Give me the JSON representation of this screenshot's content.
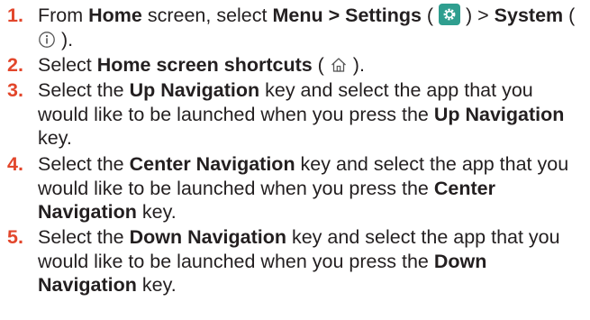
{
  "steps": [
    {
      "num": "1.",
      "t1": "From ",
      "b1": "Home",
      "t2": " screen, select ",
      "b2": "Menu > Settings",
      "t3": " ( ",
      "icon1": "settings-gear-icon",
      "t4": " ) > ",
      "b3": "System",
      "t5": " ( ",
      "icon2": "info-icon",
      "t6": " )."
    },
    {
      "num": "2.",
      "t1": "Select ",
      "b1": "Home screen shortcuts",
      "t2": " ( ",
      "icon1": "home-icon",
      "t3": " )."
    },
    {
      "num": "3.",
      "t1": "Select the ",
      "b1": "Up Navigation",
      "t2": " key and select the app that you would like to be launched when you press the ",
      "b2": "Up Navigation",
      "t3": " key."
    },
    {
      "num": "4.",
      "t1": "Select the ",
      "b1": "Center Navigation",
      "t2": " key and select the app that you would like to be launched when you press the ",
      "b2": "Center Navigation",
      "t3": " key."
    },
    {
      "num": "5.",
      "t1": "Select the ",
      "b1": "Down Navigation",
      "t2": " key and select the app that you would like to be launched when you press the ",
      "b2": "Down Navigation",
      "t3": " key."
    }
  ],
  "colors": {
    "step_number": "#e2462b",
    "text": "#231f20",
    "settings_icon_bg": "#2f9e8f"
  }
}
